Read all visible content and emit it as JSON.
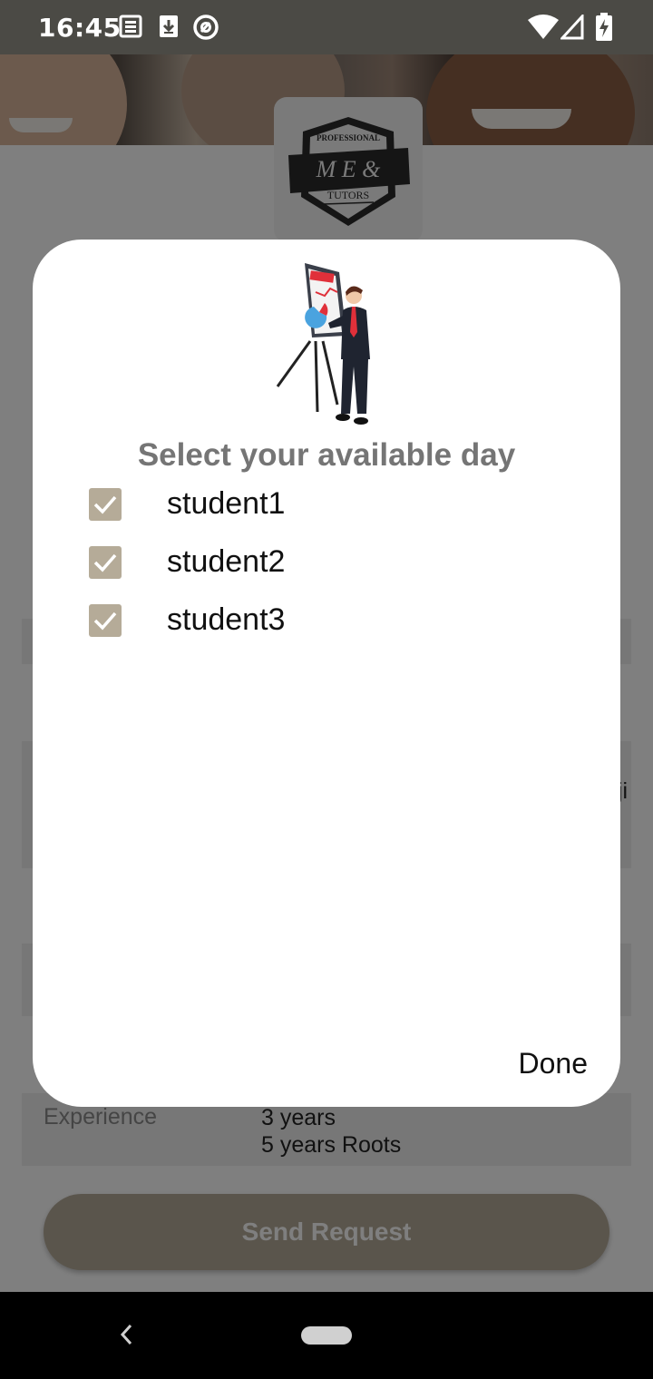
{
  "status_bar": {
    "time": "16:45",
    "left_icons": [
      "news-icon",
      "download-icon",
      "at-sign-icon"
    ],
    "right_icons": [
      "wifi-icon",
      "signal-icon",
      "battery-charging-icon"
    ]
  },
  "logo": {
    "line1": "PROFESSIONAL",
    "line2": "M E &",
    "line3": "TUTORS"
  },
  "background_form": {
    "partial_text": "ji",
    "experience_label": "Experience",
    "experience_value_1": "3 years",
    "experience_value_2": "5 years Roots",
    "send_button": "Send Request"
  },
  "dialog": {
    "title": "Select your available day",
    "options": [
      {
        "label": "student1",
        "checked": true
      },
      {
        "label": "student2",
        "checked": true
      },
      {
        "label": "student3",
        "checked": true
      }
    ],
    "done_label": "Done"
  },
  "colors": {
    "accent": "#b5ab98",
    "status_bar": "#4b4a45",
    "scrim": "#000000"
  }
}
